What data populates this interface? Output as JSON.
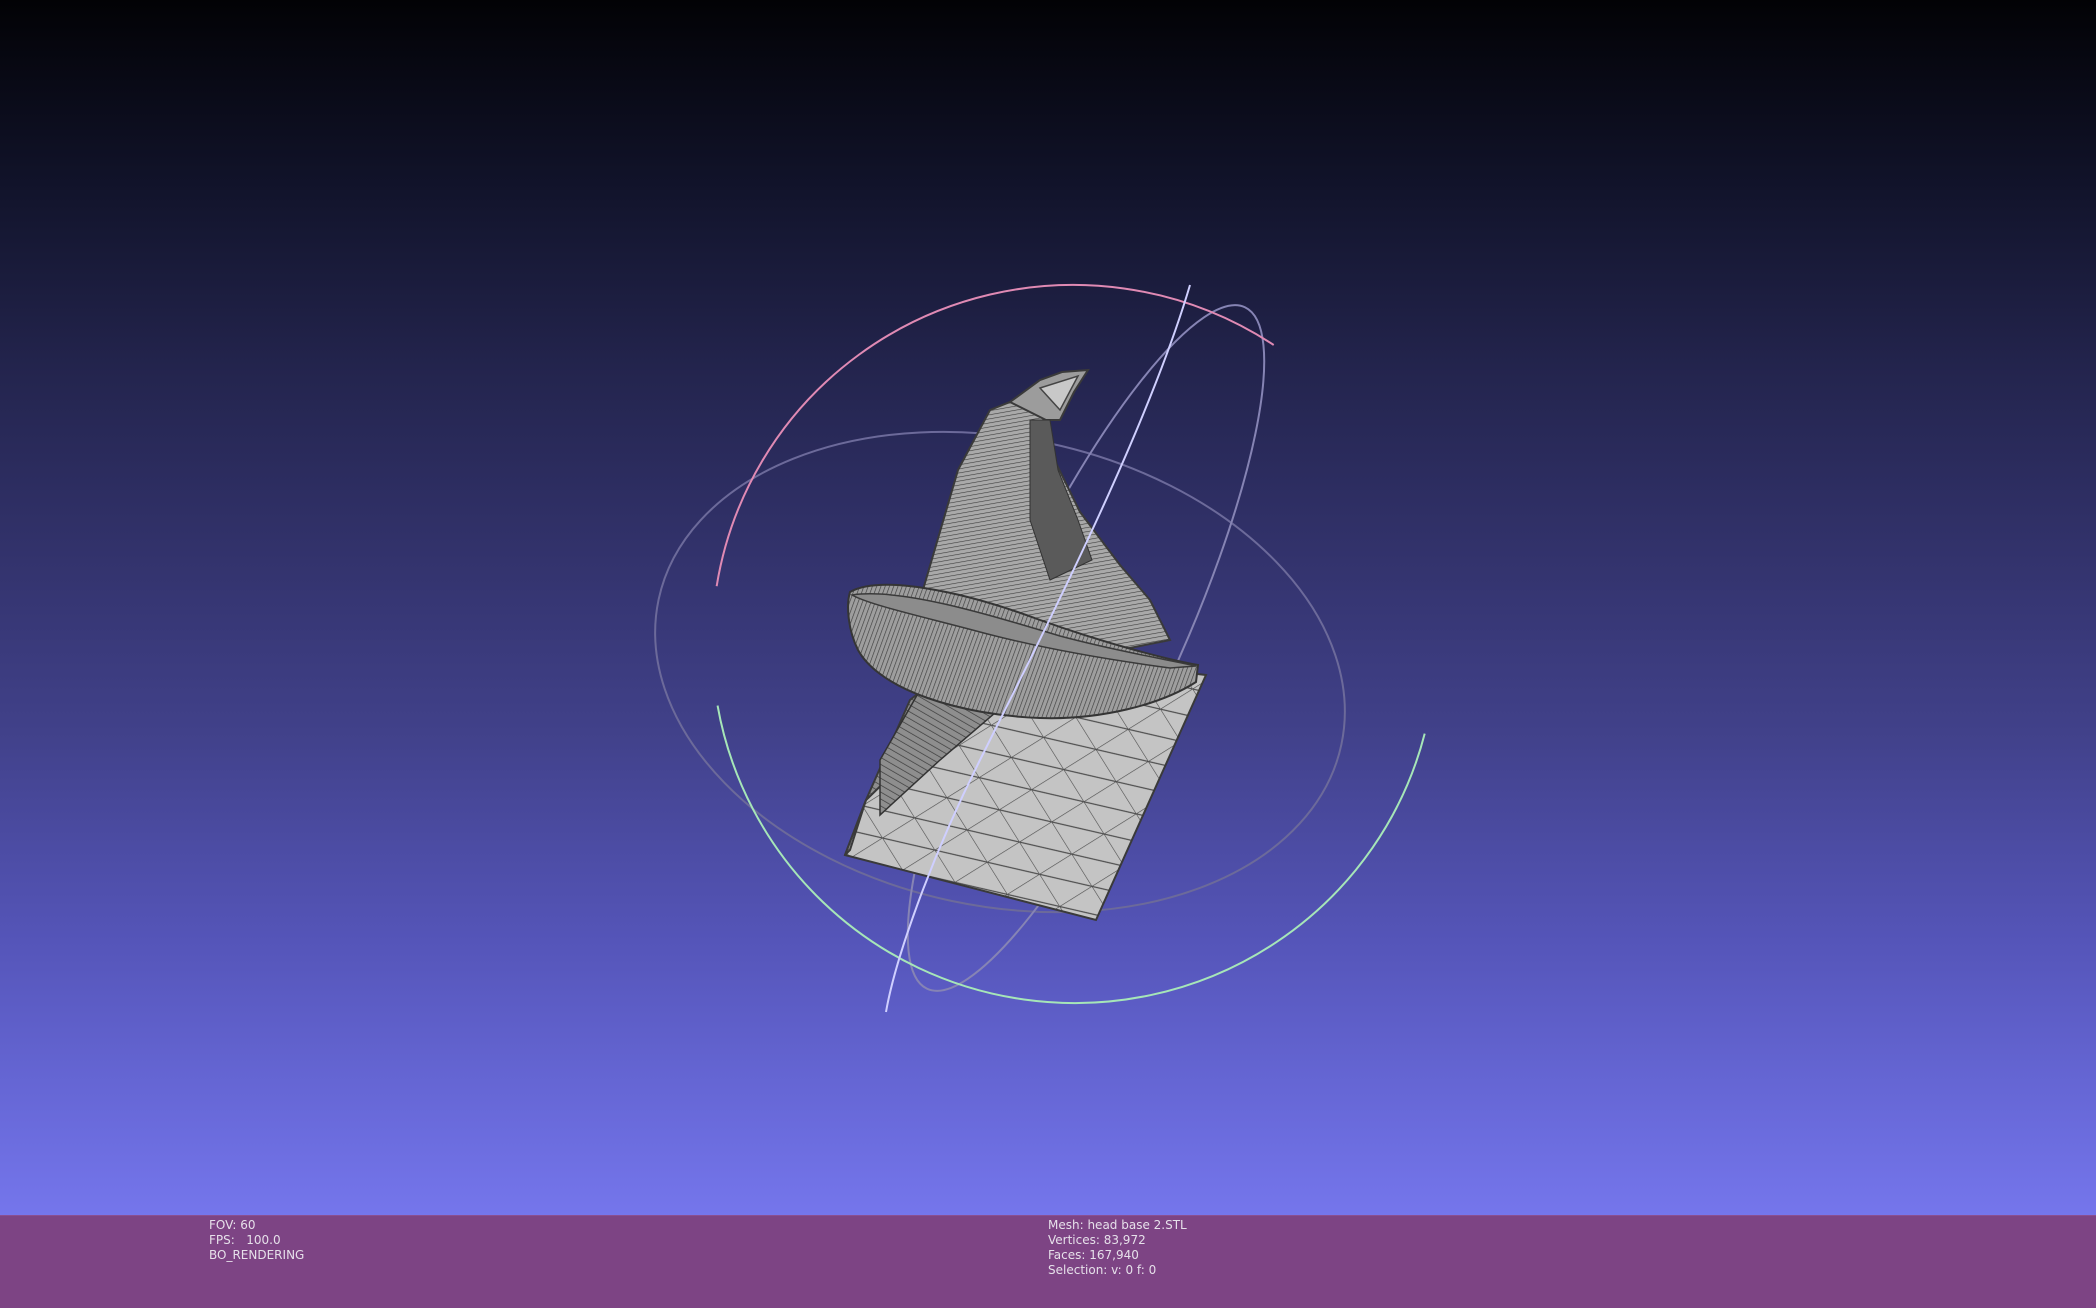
{
  "colors": {
    "background_top": "#020205",
    "background_bottom": "#7576ec",
    "info_bar": "#7d4484",
    "mesh_fill": "#b4b4b4",
    "wire": "#4a4a4a",
    "trackball_green": "#a6e6b8",
    "trackball_pink": "#e08ab4",
    "trackball_blue": "#c8c8ff"
  },
  "render_info": {
    "fov": "FOV: 60",
    "fps": "FPS:   100.0",
    "mode": "BO_RENDERING"
  },
  "mesh_info": {
    "mesh": "Mesh: head base 2.STL",
    "vertices": "Vertices: 83,972",
    "faces": "Faces: 167,940",
    "selection": "Selection: v: 0 f: 0"
  },
  "icons": {
    "trackball": "trackball-gizmo-icon",
    "mesh": "stl-mesh-model"
  }
}
